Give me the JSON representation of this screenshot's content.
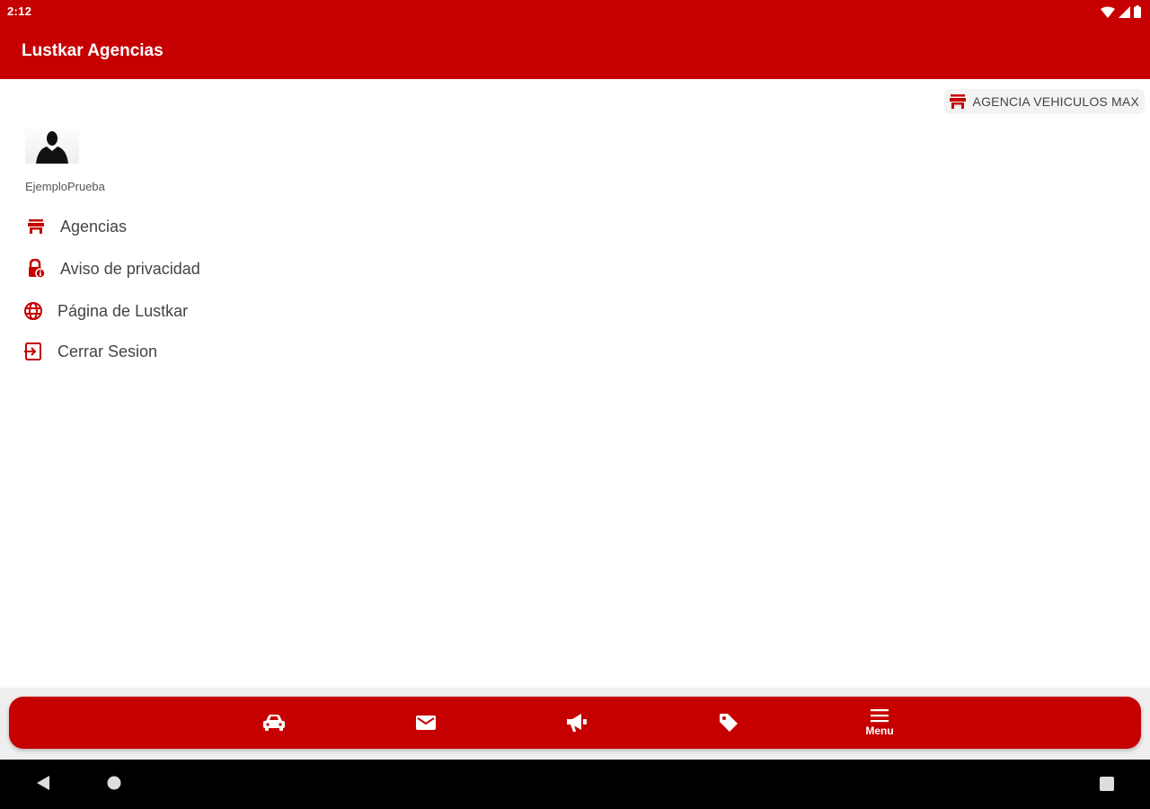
{
  "status_bar": {
    "time": "2:12"
  },
  "app_bar": {
    "title": "Lustkar Agencias"
  },
  "agency_chip": {
    "label": "AGENCIA VEHICULOS MAX",
    "icon": "store-icon"
  },
  "profile": {
    "username": "EjemploPrueba",
    "avatar_icon": "person-silhouette-icon"
  },
  "menu": {
    "items": [
      {
        "label": "Agencias",
        "icon": "store-icon"
      },
      {
        "label": "Aviso de privacidad",
        "icon": "lock-info-icon"
      },
      {
        "label": "Página de Lustkar",
        "icon": "globe-icon"
      },
      {
        "label": "Cerrar Sesion",
        "icon": "logout-icon"
      }
    ]
  },
  "bottom_nav": {
    "items": [
      {
        "icon": "car-icon",
        "label": ""
      },
      {
        "icon": "mail-icon",
        "label": ""
      },
      {
        "icon": "megaphone-icon",
        "label": ""
      },
      {
        "icon": "tag-icon",
        "label": ""
      },
      {
        "icon": "menu-icon",
        "label": "Menu"
      }
    ]
  },
  "colors": {
    "brand": "#c60000",
    "text": "#444444",
    "chip_bg": "#f3f3f3"
  }
}
